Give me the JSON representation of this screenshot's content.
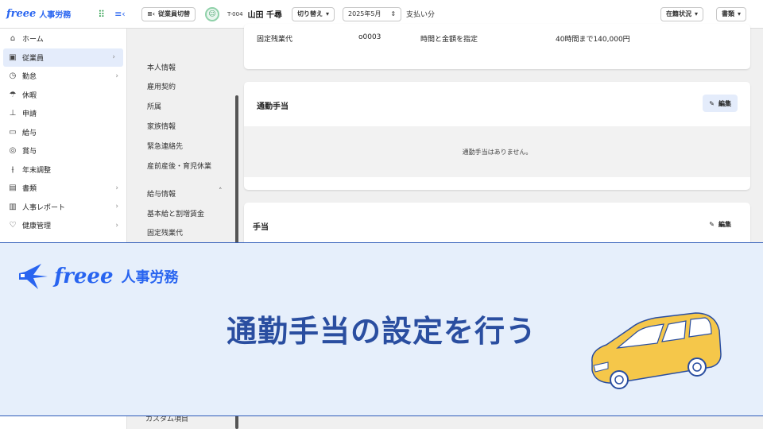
{
  "header": {
    "brand_text": "人事労務",
    "brand_logo": "freee",
    "switch_employee": "従業員切替",
    "employee_code": "T-004",
    "employee_name": "山田 千尋",
    "toggle": "切り替え",
    "month": "2025年5月",
    "pay_label": "支払い分",
    "status": "在籍状況",
    "documents": "書類"
  },
  "sidebar": {
    "items": [
      {
        "label": "ホーム",
        "icon": "home-icon",
        "chev": ""
      },
      {
        "label": "従業員",
        "icon": "id-card-icon",
        "chev": "›"
      },
      {
        "label": "勤怠",
        "icon": "clock-icon",
        "chev": "›"
      },
      {
        "label": "休暇",
        "icon": "vacation-icon",
        "chev": ""
      },
      {
        "label": "申請",
        "icon": "stamp-icon",
        "chev": ""
      },
      {
        "label": "給与",
        "icon": "wallet-icon",
        "chev": ""
      },
      {
        "label": "賞与",
        "icon": "medal-icon",
        "chev": ""
      },
      {
        "label": "年末調整",
        "icon": "adjust-icon",
        "chev": ""
      },
      {
        "label": "書類",
        "icon": "document-icon",
        "chev": "›"
      },
      {
        "label": "人事レポート",
        "icon": "report-icon",
        "chev": "›"
      },
      {
        "label": "健康管理",
        "icon": "health-icon",
        "chev": "›"
      }
    ]
  },
  "subnav": {
    "items": [
      "本人情報",
      "雇用契約",
      "所属",
      "家族情報",
      "緊急連絡先",
      "産前産後・育児休業",
      "給与情報",
      "基本給と割増賃金",
      "固定残業代"
    ],
    "bottom_item": "カスタム項目"
  },
  "overtime_row": {
    "name": "固定残業代",
    "code": "o0003",
    "method": "時間と金額を指定",
    "amount": "40時間まで140,000円"
  },
  "commute": {
    "title": "通勤手当",
    "edit": "編集",
    "empty": "通勤手当はありません。"
  },
  "allowance": {
    "title": "手当",
    "edit": "編集"
  },
  "banner": {
    "logo_word": "freee",
    "logo_sub": "人事労務",
    "title": "通勤手当の設定を行う"
  },
  "colors": {
    "brand": "#2864f0",
    "banner_bg": "#e6effb",
    "title": "#2a4ea0",
    "car": "#f5c74a"
  }
}
